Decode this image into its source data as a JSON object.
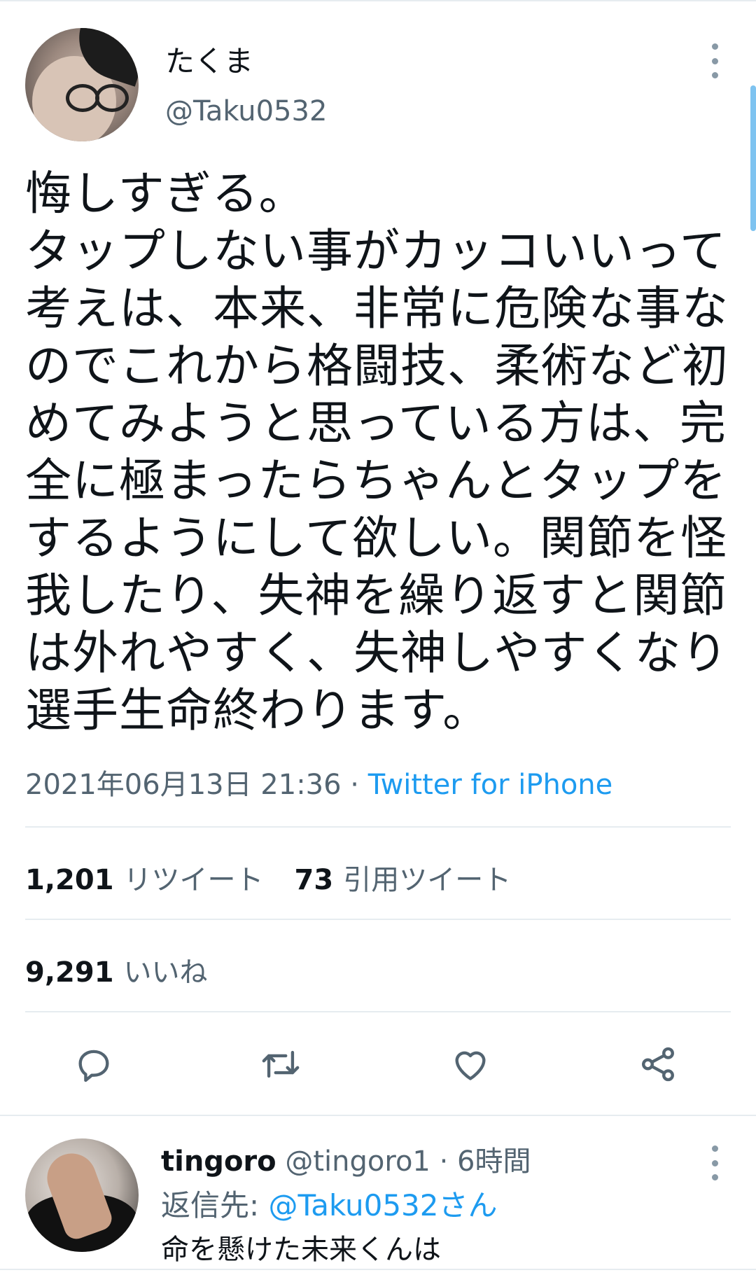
{
  "tweet": {
    "author_name": "たくま",
    "author_handle": "@Taku0532",
    "text": "悔しすぎる。\nタップしない事がカッコいいって考えは、本来、非常に危険な事なのでこれから格闘技、柔術など初めてみようと思っている方は、完全に極まったらちゃんとタップをするようにして欲しい。関節を怪我したり、失神を繰り返すと関節は外れやすく、失神しやすくなり選手生命終わります。",
    "timestamp": "2021年06月13日 21:36",
    "separator": " · ",
    "source": "Twitter for iPhone"
  },
  "stats": {
    "retweets_count": "1,201",
    "retweets_label": "リツイート",
    "quotes_count": "73",
    "quotes_label": "引用ツイート",
    "likes_count": "9,291",
    "likes_label": "いいね"
  },
  "actions": [
    {
      "icon": "reply-icon"
    },
    {
      "icon": "retweet-icon"
    },
    {
      "icon": "like-icon"
    },
    {
      "icon": "share-icon"
    }
  ],
  "reply": {
    "author_name": "tingoro",
    "author_handle": "@tingoro1",
    "separator": " · ",
    "time": "6時間",
    "reply_to_prefix": "返信先: ",
    "reply_to_mention": "@Taku0532さん",
    "text": "命を懸けた未来くんは"
  },
  "colors": {
    "accent": "#1d9bf0",
    "text_primary": "#0f1419",
    "text_secondary": "#536471",
    "divider": "#e6ecf0"
  }
}
